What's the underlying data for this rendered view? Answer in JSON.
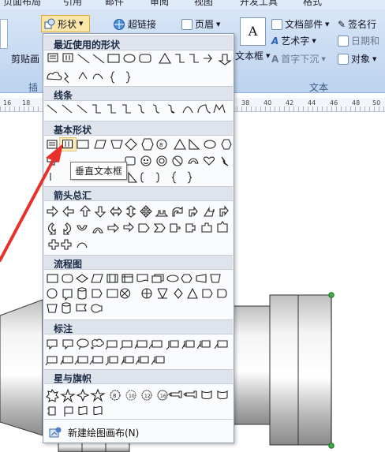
{
  "ribbon": {
    "tabs": [
      "页面布局",
      "引用",
      "邮件",
      "审阅",
      "视图",
      "开发工具",
      "格式"
    ],
    "shapes_button": "形状",
    "hyperlink": "超链接",
    "header": "页眉",
    "paste": "剪贴画",
    "text_box": "文本框",
    "doc_parts": "文档部件",
    "wordart": "艺术字",
    "dropcap": "首字下沉",
    "signature": "签名行",
    "datetime": "日期和",
    "object": "对象",
    "group_insert_partial": "插",
    "group_text": "文本"
  },
  "ruler": {
    "left_numbers": [
      "16",
      "18"
    ],
    "right_numbers": [
      "38",
      "40",
      "42",
      "44",
      "46",
      "48",
      "50"
    ]
  },
  "menu": {
    "sections": [
      "最近使用的形状",
      "线条",
      "基本形状",
      "箭头总汇",
      "流程图",
      "标注",
      "星与旗帜"
    ],
    "tooltip": "垂直文本框",
    "new_canvas": "新建绘图画布(N)"
  },
  "colors": {
    "ribbon_bg": "#c8dbf2",
    "section_bg": "#dfe4ec",
    "highlight": "#fde9a8",
    "arrow": "#e8312a",
    "selection_handle": "#3cb043"
  }
}
